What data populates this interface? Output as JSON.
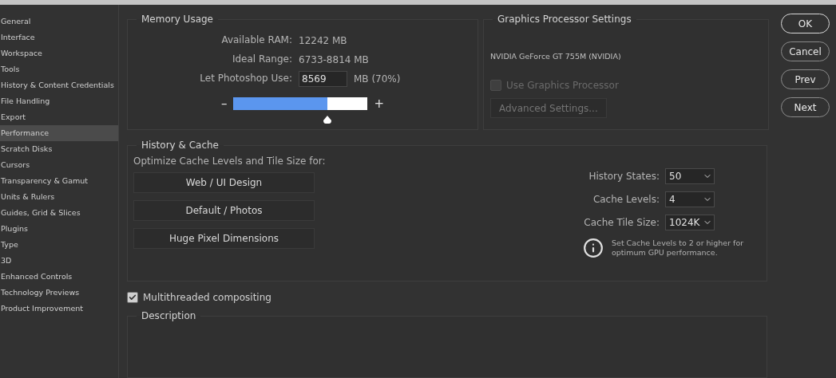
{
  "sidebar": {
    "items": [
      {
        "label": "General",
        "selected": false
      },
      {
        "label": "Interface",
        "selected": false
      },
      {
        "label": "Workspace",
        "selected": false
      },
      {
        "label": "Tools",
        "selected": false
      },
      {
        "label": "History & Content Credentials",
        "selected": false
      },
      {
        "label": "File Handling",
        "selected": false
      },
      {
        "label": "Export",
        "selected": false
      },
      {
        "label": "Performance",
        "selected": true
      },
      {
        "label": "Scratch Disks",
        "selected": false
      },
      {
        "label": "Cursors",
        "selected": false
      },
      {
        "label": "Transparency & Gamut",
        "selected": false
      },
      {
        "label": "Units & Rulers",
        "selected": false
      },
      {
        "label": "Guides, Grid & Slices",
        "selected": false
      },
      {
        "label": "Plugins",
        "selected": false
      },
      {
        "label": "Type",
        "selected": false
      },
      {
        "label": "3D",
        "selected": false
      },
      {
        "label": "Enhanced Controls",
        "selected": false
      },
      {
        "label": "Technology Previews",
        "selected": false
      },
      {
        "label": "Product Improvement",
        "selected": false
      }
    ]
  },
  "memory_usage": {
    "title": "Memory Usage",
    "rows": [
      {
        "label": "Available RAM:",
        "value": "12242 MB"
      },
      {
        "label": "Ideal Range:",
        "value": "6733-8814 MB"
      }
    ],
    "use": {
      "label": "Let Photoshop Use:",
      "value": "8569",
      "unit": "MB (70%)"
    },
    "slider": {
      "minus": "–",
      "plus": "+",
      "level": 0.7
    }
  },
  "graphics": {
    "title": "Graphics Processor Settings",
    "gpu": "NVIDIA GeForce GT 755M (NVIDIA)",
    "use_gpu": {
      "label": "Use Graphics Processor",
      "checked": false,
      "disabled": true
    },
    "advanced_button": {
      "label": "Advanced Settings...",
      "disabled": true
    }
  },
  "history_cache": {
    "title": "History & Cache",
    "optimize_label": "Optimize Cache Levels and Tile Size for:",
    "presets": [
      "Web / UI Design",
      "Default / Photos",
      "Huge Pixel Dimensions"
    ],
    "settings": [
      {
        "label": "History States:",
        "value": "50"
      },
      {
        "label": "Cache Levels:",
        "value": "4"
      },
      {
        "label": "Cache Tile Size:",
        "value": "1024K"
      }
    ],
    "note": "Set Cache Levels to 2 or higher for optimum GPU performance."
  },
  "multithreaded": {
    "label": "Multithreaded compositing",
    "checked": true
  },
  "description": {
    "title": "Description"
  },
  "buttons": [
    {
      "label": "OK",
      "default": true
    },
    {
      "label": "Cancel",
      "default": false
    },
    {
      "label": "Prev",
      "default": false
    },
    {
      "label": "Next",
      "default": false
    }
  ]
}
